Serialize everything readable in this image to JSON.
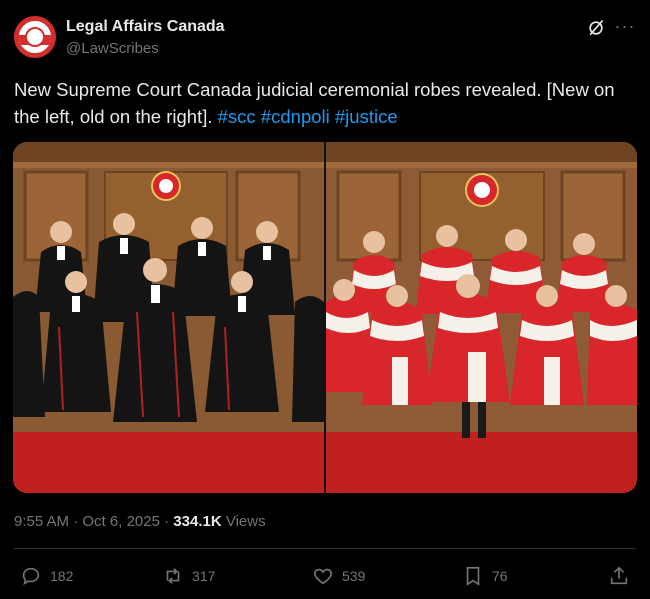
{
  "author": {
    "display_name": "Legal Affairs Canada",
    "handle": "@LawScribes"
  },
  "tweet": {
    "text_prefix": "New Supreme Court Canada judicial ceremonial robes revealed. [New on the left, old on the right]. ",
    "hashtags": [
      "#scc",
      "#cdnpoli",
      "#justice"
    ]
  },
  "media": {
    "left_photo": "new robes",
    "right_photo": "old robes"
  },
  "meta": {
    "time": "9:55 AM",
    "date": "Oct 6, 2025",
    "views_count": "334.1K",
    "views_label": "Views"
  },
  "actions": {
    "replies": "182",
    "reposts": "317",
    "likes": "539",
    "bookmarks": "76"
  },
  "colors": {
    "background": "#000000",
    "text": "#e7e9ea",
    "muted": "#71767b",
    "link": "#1d9bf0",
    "robe_new": "#111111",
    "robe_old": "#d8262b"
  }
}
